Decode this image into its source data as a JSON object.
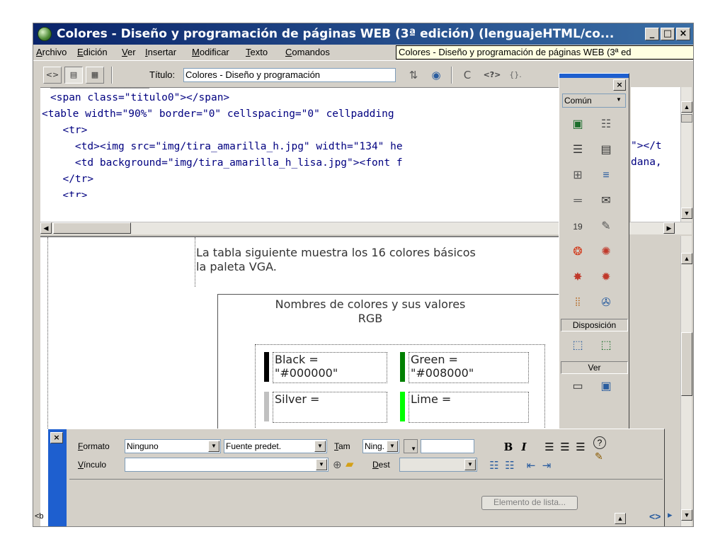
{
  "window": {
    "title": "Colores - Diseño y programación de páginas WEB (3ª edición) (lenguajeHTML/co...",
    "controls": {
      "minimize": "_",
      "maximize": "□",
      "close": "×"
    }
  },
  "menubar": [
    "Archivo",
    "Edición",
    "Ver",
    "Insertar",
    "Modificar",
    "Texto",
    "Comandos"
  ],
  "tooltip": "Colores - Diseño y programación de páginas WEB (3ª ed",
  "toolbar": {
    "code_view_icon": "<>",
    "title_label": "Título:",
    "title_value": "Colores - Diseño y programación",
    "refresh_icon": "C",
    "code_nav_icon": "<?>",
    "braces_icon": "{}."
  },
  "code": {
    "lines": [
      {
        "pre": "<span class=\"titulo0\"></span>"
      },
      {
        "pre": "<table width=\"90%\" border=\"0\" cellspacing=\"0\" cellpadding"
      },
      {
        "pre": "  <tr>"
      },
      {
        "pre": "    <td><img src=\"img/tira_amarilla_h.jpg\" width=\"134\" he"
      },
      {
        "pre": "    <td background=\"img/tira_amarilla_h_lisa.jpg\"><font f"
      },
      {
        "pre": "  </tr>"
      },
      {
        "pre": "  <tr>"
      }
    ],
    "right_fragments": [
      "\"></t",
      "dana,"
    ]
  },
  "design": {
    "para1": "La tabla siguiente muestra los 16 colores básicos",
    "para2": "la paleta VGA.",
    "table_title_1": "Nombres de colores y sus valores",
    "table_title_2": "RGB",
    "cells": [
      {
        "name": "Black =",
        "value": "\"#000000\"",
        "color": "#000000"
      },
      {
        "name": "Green =",
        "value": "\"#008000\"",
        "color": "#008000"
      },
      {
        "name": "Silver =",
        "value": "",
        "color": "#c0c0c0"
      },
      {
        "name": "Lime =",
        "value": "",
        "color": "#00ff00"
      }
    ]
  },
  "insert_panel": {
    "close": "×",
    "category": "Común",
    "section_layout": "Disposición",
    "section_view": "Ver"
  },
  "properties": {
    "close": "×",
    "format_label": "Formato",
    "format_value": "Ninguno",
    "font_value": "Fuente predet.",
    "size_label": "Tam",
    "size_value": "Ning.",
    "link_label": "Vínculo",
    "link_value": "",
    "target_label": "Dest",
    "target_value": "",
    "bold": "B",
    "italic": "I",
    "help": "?",
    "list_item_button": "Elemento de lista..."
  },
  "status": {
    "tag": "<b",
    "code_icon": "<>"
  }
}
